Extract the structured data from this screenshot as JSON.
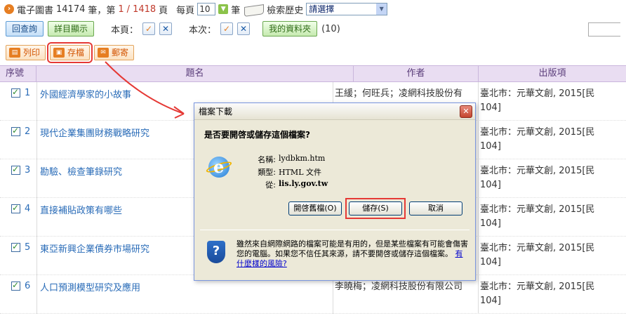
{
  "topbar": {
    "collection": "電子圖書",
    "total_count": "14174",
    "unit": "筆，第",
    "page_current": "1",
    "page_sep": "/",
    "page_total": "1418",
    "page_unit": "頁",
    "per_page_label": "每頁",
    "per_page_value": "10",
    "per_page_unit": "筆",
    "history_label": "檢索歷史",
    "history_select": "請選擇"
  },
  "toolbar": {
    "back_label": "回查詢",
    "detail_label": "詳目顯示",
    "page_label": "本頁：",
    "session_label": "本次：",
    "folder_label": "我的資料夾",
    "folder_count": "(10)"
  },
  "actions": {
    "print": "列印",
    "save": "存檔",
    "mail": "郵寄"
  },
  "table": {
    "headers": {
      "seq": "序號",
      "title": "題名",
      "author": "作者",
      "pub": "出版項"
    },
    "rows": [
      {
        "num": "1",
        "title": "外國經濟學家的小故事",
        "author": "王緩；何旺兵；凌網科技股份有",
        "pub": "臺北市：元華文創, 2015[民104]"
      },
      {
        "num": "2",
        "title": "現代企業集團財務戰略研究",
        "author": "",
        "pub": "臺北市：元華文創, 2015[民104]"
      },
      {
        "num": "3",
        "title": "勘驗、檢查筆錄研究",
        "author": "",
        "pub": "臺北市：元華文創, 2015[民104]"
      },
      {
        "num": "4",
        "title": "直接補貼政策有哪些",
        "author": "",
        "pub": "臺北市：元華文創, 2015[民104]"
      },
      {
        "num": "5",
        "title": "東亞新興企業債券市場研究",
        "author": "",
        "pub": "臺北市：元華文創, 2015[民104]"
      },
      {
        "num": "6",
        "title": "人口預測模型研究及應用",
        "author": "李曉梅；凌網科技股份有限公司",
        "pub": "臺北市：元華文創, 2015[民104]"
      }
    ]
  },
  "dialog": {
    "title": "檔案下載",
    "close": "✕",
    "question": "是否要開啓或儲存這個檔案?",
    "name_label": "名稱:",
    "name_value": "lydbkm.htm",
    "type_label": "類型:",
    "type_value": "HTML 文件",
    "from_label": "從:",
    "from_value": "lis.ly.gov.tw",
    "open_btn": "開啓舊檔(O)",
    "save_btn": "儲存(S)",
    "cancel_btn": "取消",
    "warning": "雖然來自網際網路的檔案可能是有用的，但是某些檔案有可能會傷害您的電腦。如果您不信任其來源，請不要開啓或儲存這個檔案。",
    "risk_link": "有什麼樣的風險?"
  },
  "colors": {
    "accent_red": "#e53935",
    "link_blue": "#2a6cb8",
    "header_purple": "#e9ddf2"
  }
}
